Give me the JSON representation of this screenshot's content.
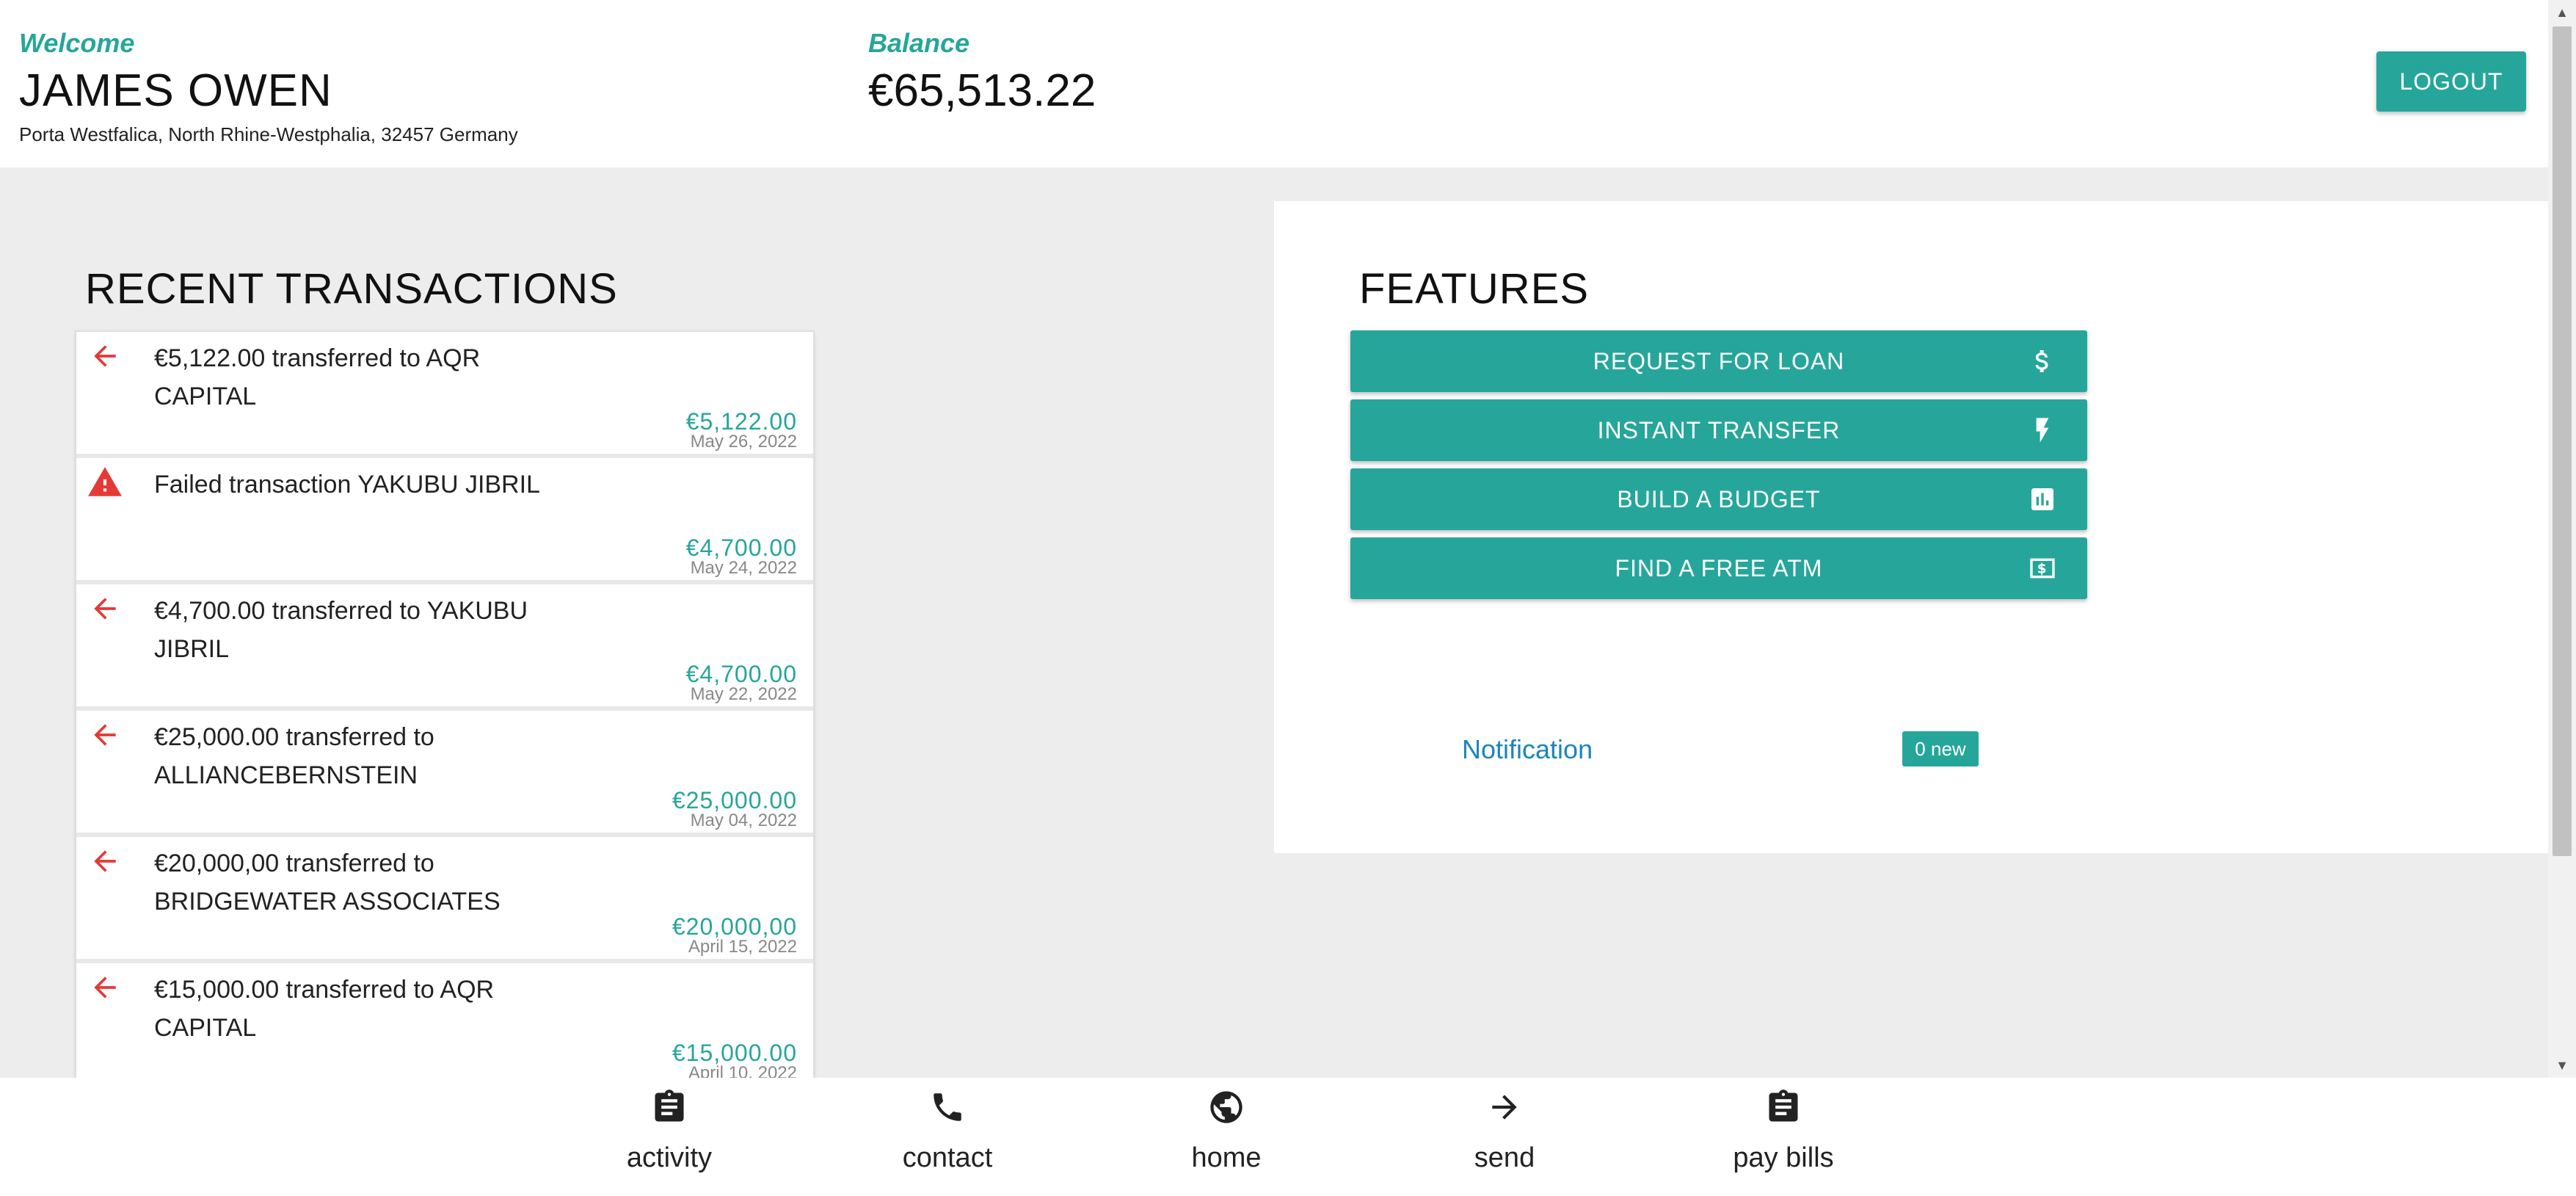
{
  "header": {
    "welcome_label": "Welcome",
    "user_name": "JAMES OWEN",
    "address": "Porta Westfalica, North Rhine-Westphalia, 32457 Germany",
    "balance_label": "Balance",
    "balance_value": "€65,513.22",
    "logout_label": "LOGOUT"
  },
  "transactions": {
    "title": "RECENT TRANSACTIONS",
    "items": [
      {
        "icon": "arrow-left-icon",
        "description": "€5,122.00 transferred to AQR CAPITAL",
        "amount": "€5,122.00",
        "date": "May 26, 2022"
      },
      {
        "icon": "warning-icon",
        "description": "Failed transaction YAKUBU JIBRIL",
        "amount": "€4,700.00",
        "date": "May 24, 2022"
      },
      {
        "icon": "arrow-left-icon",
        "description": "€4,700.00 transferred to YAKUBU JIBRIL",
        "amount": "€4,700.00",
        "date": "May 22, 2022"
      },
      {
        "icon": "arrow-left-icon",
        "description": "€25,000.00 transferred to ALLIANCEBERNSTEIN",
        "amount": "€25,000.00",
        "date": "May 04, 2022"
      },
      {
        "icon": "arrow-left-icon",
        "description": "€20,000,00 transferred to BRIDGEWATER ASSOCIATES",
        "amount": "€20,000,00",
        "date": "April 15, 2022"
      },
      {
        "icon": "arrow-left-icon",
        "description": "€15,000.00 transferred to AQR CAPITAL",
        "amount": "€15,000.00",
        "date": "April 10, 2022"
      }
    ]
  },
  "features": {
    "title": "FEATURES",
    "buttons": [
      {
        "label": "REQUEST FOR LOAN",
        "icon": "dollar-icon"
      },
      {
        "label": "INSTANT TRANSFER",
        "icon": "lightning-icon"
      },
      {
        "label": "BUILD A BUDGET",
        "icon": "bar-chart-icon"
      },
      {
        "label": "FIND A FREE ATM",
        "icon": "cash-icon"
      }
    ],
    "notification_label": "Notification",
    "notification_badge": "0 new"
  },
  "bottom_nav": [
    {
      "label": "activity",
      "icon": "clipboard-icon"
    },
    {
      "label": "contact",
      "icon": "phone-icon"
    },
    {
      "label": "home",
      "icon": "globe-icon"
    },
    {
      "label": "send",
      "icon": "arrow-right-icon"
    },
    {
      "label": "pay bills",
      "icon": "clipboard-icon"
    }
  ],
  "colors": {
    "accent": "#26a69a",
    "outgoing": "#e53935",
    "link": "#1a86b8"
  }
}
